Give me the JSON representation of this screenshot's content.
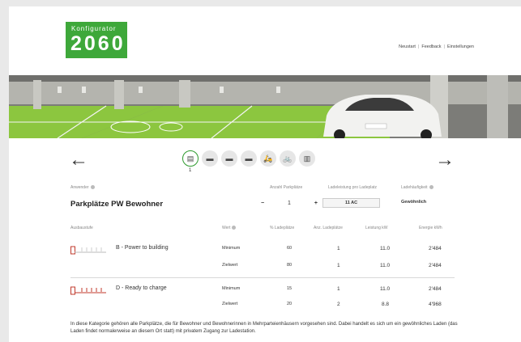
{
  "logo": {
    "top_text": "Konfigurator",
    "big_text": "2060"
  },
  "topnav": {
    "items": [
      "Neustart",
      "Feedback",
      "Einstellungen"
    ],
    "separator": "|"
  },
  "nav": {
    "prev_arrow": "←",
    "next_arrow": "→"
  },
  "category_icons": [
    {
      "name": "garage-icon",
      "glyph": "▤",
      "active": true
    },
    {
      "name": "parking-icon",
      "glyph": "▬",
      "active": false
    },
    {
      "name": "bus-icon",
      "glyph": "▬",
      "active": false
    },
    {
      "name": "car-icon",
      "glyph": "▬",
      "active": false
    },
    {
      "name": "moped-icon",
      "glyph": "🛵",
      "active": false
    },
    {
      "name": "bicycle-icon",
      "glyph": "🚲",
      "active": false
    },
    {
      "name": "document-icon",
      "glyph": "▥",
      "active": false
    }
  ],
  "icon_caption": "1",
  "config": {
    "anwender_label": "Anwender",
    "title": "Parkplätze PW Bewohner",
    "anzahl_label": "Anzahl Parkplätze",
    "anzahl_minus": "−",
    "anzahl_value": "1",
    "anzahl_plus": "+",
    "ladeleistung_label": "Ladeleistung pro Ladeplatz",
    "ladeleistung_value": "11 AC",
    "ladehaeufigkeit_label": "Ladehäufigkeit",
    "ladehaeufigkeit_value": "Gewöhnlich"
  },
  "table": {
    "headers": {
      "ausbaustufe": "Ausbaustufe",
      "wert": "Wert",
      "ladeplaetze_pct": "% Ladeplätze",
      "anz_ladeplaetze": "Anz. Ladeplätze",
      "leistung": "Leistung kW",
      "energie": "Energie kWh"
    },
    "stages": [
      {
        "label": "B - Power to building",
        "rows": [
          {
            "wert": "Minimum",
            "pct": "60",
            "anz": "1",
            "leistung": "11.0",
            "energie": "2'484"
          },
          {
            "wert": "Zielwert",
            "pct": "80",
            "anz": "1",
            "leistung": "11.0",
            "energie": "2'484"
          }
        ]
      },
      {
        "label": "D - Ready to charge",
        "rows": [
          {
            "wert": "Minimum",
            "pct": "15",
            "anz": "1",
            "leistung": "11.0",
            "energie": "2'484"
          },
          {
            "wert": "Zielwert",
            "pct": "20",
            "anz": "2",
            "leistung": "8.8",
            "energie": "4'968"
          }
        ]
      }
    ]
  },
  "description": "In diese Kategorie gehören alle Parkplätze, die für Bewohner und Bewohnerinnen in Mehrparteienhäusern vorgesehen sind. Dabei handelt es sich um ein gewöhnliches Laden (das Laden findet normalerweise an diesem Ort statt) mit privatem Zugang zur Ladestation.",
  "colors": {
    "brand_green": "#3ea83a",
    "floor_green": "#8cc63f",
    "accent_green": "#2e9a2e"
  }
}
